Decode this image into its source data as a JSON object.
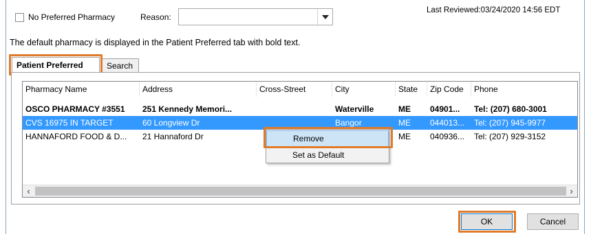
{
  "top": {
    "no_preferred_label": "No Preferred Pharmacy",
    "reason_label": "Reason:",
    "reason_value": "",
    "last_reviewed": "Last Reviewed:03/24/2020 14:56 EDT"
  },
  "info_text": "The default pharmacy is displayed in the Patient Preferred tab with bold text.",
  "tabs": [
    {
      "label": "Patient Preferred"
    },
    {
      "label": "Search"
    }
  ],
  "table": {
    "columns": [
      "Pharmacy Name",
      "Address",
      "Cross-Street",
      "City",
      "State",
      "Zip Code",
      "Phone"
    ],
    "rows": [
      {
        "name": "OSCO PHARMACY #3551",
        "address": "251 Kennedy Memori...",
        "cross": "",
        "city": "Waterville",
        "state": "ME",
        "zip": "04901...",
        "phone": "Tel: (207) 680-3001"
      },
      {
        "name": "CVS 16975 IN TARGET",
        "address": "60 Longview Dr",
        "cross": "",
        "city": "Bangor",
        "state": "ME",
        "zip": "044013...",
        "phone": "Tel: (207) 945-9977"
      },
      {
        "name": "HANNAFORD FOOD & D...",
        "address": "21 Hannaford Dr",
        "cross": "",
        "city": "",
        "state": "ME",
        "zip": "040936...",
        "phone": "Tel: (207) 929-3152"
      }
    ]
  },
  "context_menu": {
    "items": [
      "Remove",
      "Set as Default"
    ]
  },
  "buttons": {
    "ok": "OK",
    "cancel": "Cancel"
  },
  "colors": {
    "highlight": "#e07b2b",
    "selection": "#3399ff"
  }
}
